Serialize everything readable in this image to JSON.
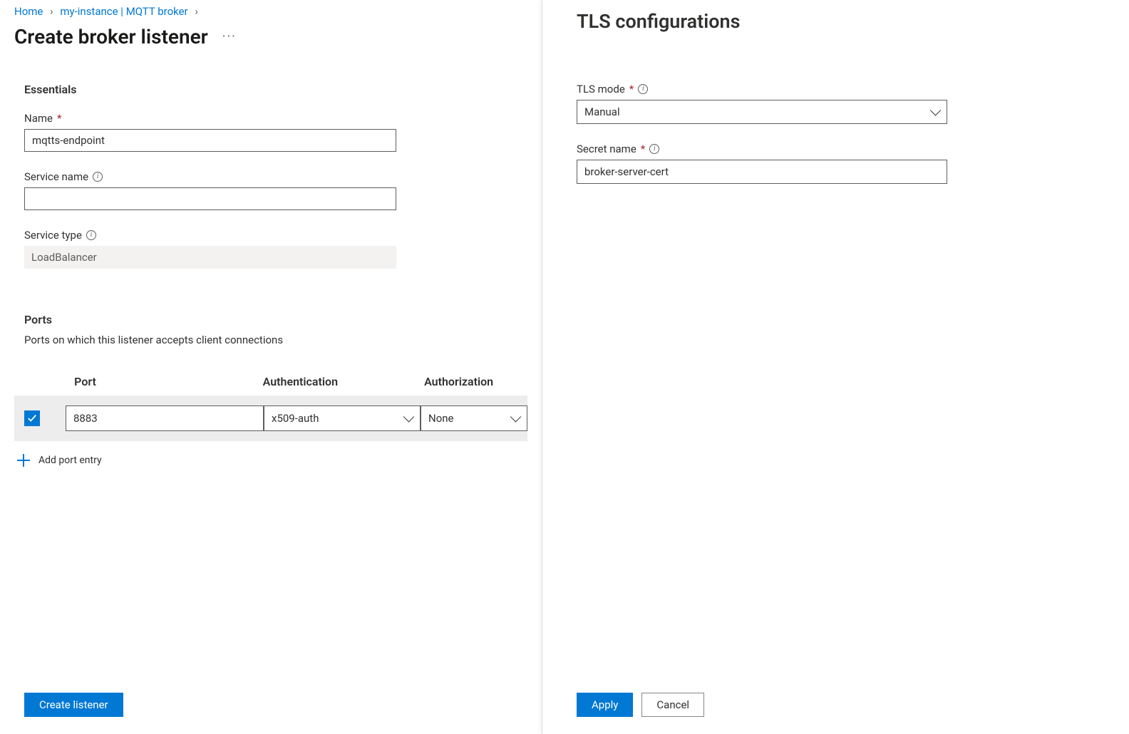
{
  "breadcrumb": {
    "home": "Home",
    "instance": "my-instance | MQTT broker"
  },
  "main": {
    "title": "Create broker listener",
    "essentials": {
      "heading": "Essentials",
      "name_label": "Name",
      "name_value": "mqtts-endpoint",
      "service_name_label": "Service name",
      "service_name_value": "",
      "service_type_label": "Service type",
      "service_type_value": "LoadBalancer"
    },
    "ports": {
      "heading": "Ports",
      "desc": "Ports on which this listener accepts client connections",
      "columns": {
        "port": "Port",
        "auth": "Authentication",
        "authz": "Authorization"
      },
      "rows": [
        {
          "checked": true,
          "port": "8883",
          "auth": "x509-auth",
          "authz": "None"
        }
      ],
      "add_label": "Add port entry"
    },
    "footer": {
      "create": "Create listener"
    }
  },
  "side": {
    "title": "TLS configurations",
    "tls_mode_label": "TLS mode",
    "tls_mode_value": "Manual",
    "secret_label": "Secret name",
    "secret_value": "broker-server-cert",
    "apply": "Apply",
    "cancel": "Cancel"
  }
}
